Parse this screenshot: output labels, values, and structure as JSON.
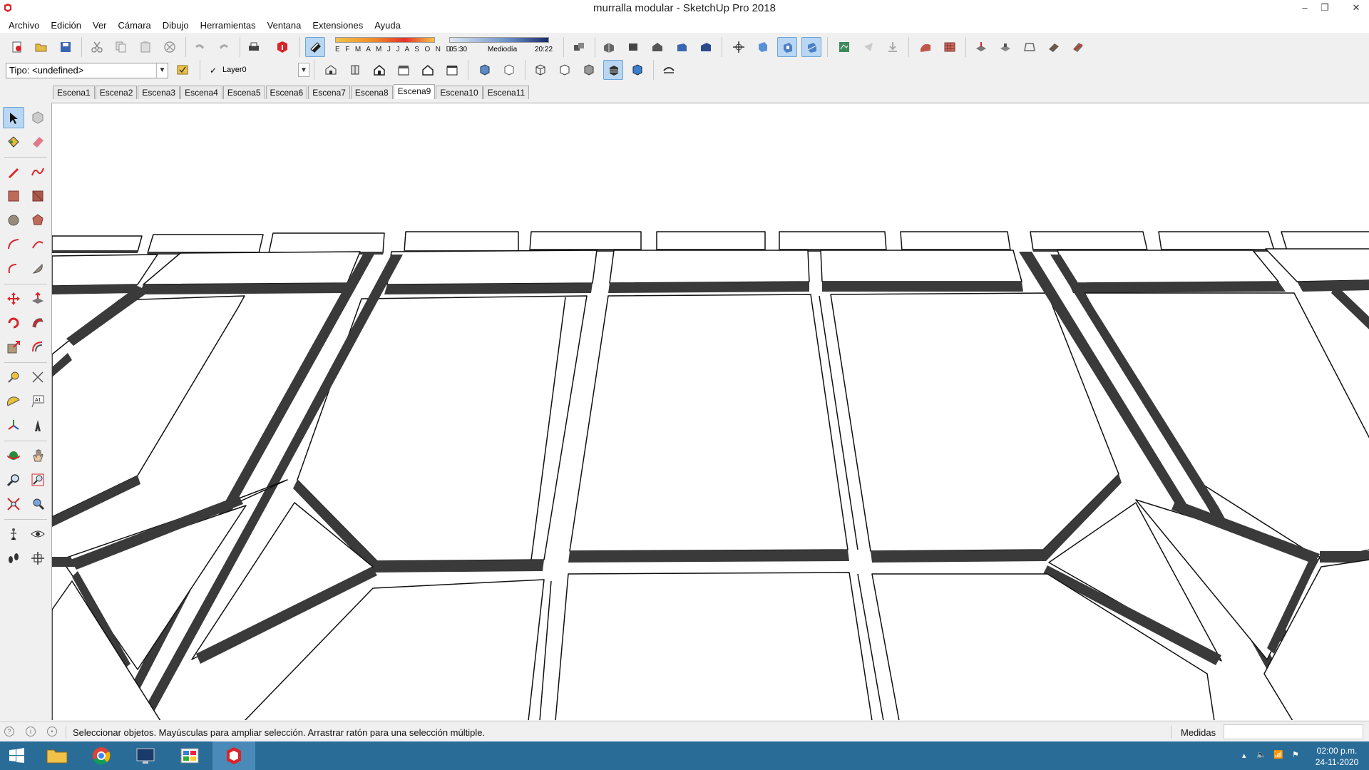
{
  "window": {
    "title": "murralla modular - SketchUp Pro 2018",
    "minimize": "–",
    "restore": "❐",
    "close": "✕"
  },
  "menu": [
    "Archivo",
    "Edición",
    "Ver",
    "Cámara",
    "Dibujo",
    "Herramientas",
    "Ventana",
    "Extensiones",
    "Ayuda"
  ],
  "toolbar": {
    "type_combo": "Tipo: <undefined>",
    "layer_check": "✓",
    "layer_combo": "Layer0",
    "shadow": {
      "months": "E F M A M J J A S O N D",
      "time_start": "05:30",
      "time_mid": "Mediodía",
      "time_end": "20:22"
    }
  },
  "scenes": {
    "tabs": [
      "Escena1",
      "Escena2",
      "Escena3",
      "Escena4",
      "Escena5",
      "Escena6",
      "Escena7",
      "Escena8",
      "Escena9",
      "Escena10",
      "Escena11"
    ],
    "active": "Escena9"
  },
  "status": {
    "message": "Seleccionar objetos. Mayúsculas para ampliar selección. Arrastrar ratón para una selección múltiple.",
    "measurements_label": "Medidas",
    "measurements_value": ""
  },
  "taskbar": {
    "time": "02:00 p.m.",
    "date": "24-11-2020"
  },
  "colors": {
    "accent": "#b9d7f2",
    "taskbar": "#2a6c98",
    "model_edge": "#3a3a3a"
  }
}
